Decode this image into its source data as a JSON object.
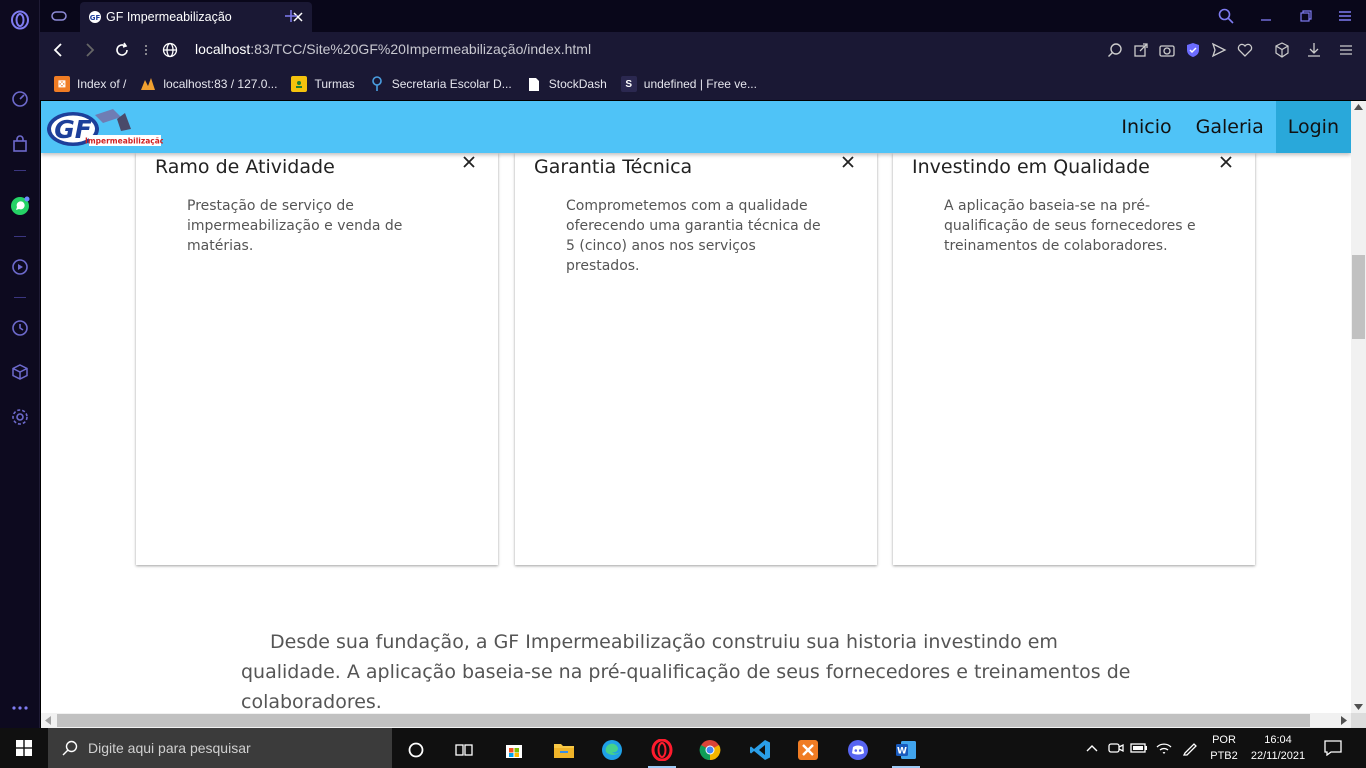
{
  "browser": {
    "tab": {
      "title": "GF Impermeabilização"
    },
    "url": {
      "host": "localhost",
      "rest": ":83/TCC/Site%20GF%20Impermeabilização/index.html"
    },
    "bookmarks": [
      {
        "label": "Index of /",
        "color": "#f07c24"
      },
      {
        "label": "localhost:83 / 127.0...",
        "color": "#f0a030"
      },
      {
        "label": "Turmas",
        "color": "#f4c20d"
      },
      {
        "label": "Secretaria Escolar D...",
        "color": "#4a9ee0"
      },
      {
        "label": "StockDash",
        "color": "#ffffff"
      },
      {
        "label": "undefined | Free ve...",
        "color": "#1a1834"
      }
    ]
  },
  "site": {
    "logo_text": "Impermeabilização",
    "logo_letters": "GF",
    "nav": [
      {
        "label": "Inicio"
      },
      {
        "label": "Galeria"
      },
      {
        "label": "Login"
      }
    ],
    "cards": [
      {
        "title": "Ramo de Atividade",
        "text": "Prestação de serviço de impermeabilização e venda de matérias."
      },
      {
        "title": "Garantia Técnica",
        "text": "Comprometemos com a qualidade oferecendo uma garantia técnica de 5 (cinco) anos nos serviços prestados."
      },
      {
        "title": "Investindo em Qualidade",
        "text": "A aplicação baseia-se na pré-qualificação de seus fornecedores e treinamentos de colaboradores."
      }
    ],
    "paragraph": "Desde sua fundação, a GF Impermeabilização construiu sua historia investindo em qualidade. A aplicação baseia-se na pré-qualificação de seus fornecedores e treinamentos de colaboradores."
  },
  "taskbar": {
    "search_placeholder": "Digite aqui para pesquisar",
    "lang": {
      "line1": "POR",
      "line2": "PTB2"
    },
    "clock": {
      "time": "16:04",
      "date": "22/11/2021"
    }
  },
  "colors": {
    "navbar": "#4fc3f7",
    "nav_active": "#29a8da",
    "browser_chrome": "#1a1834",
    "accent": "#6c5ce7"
  }
}
